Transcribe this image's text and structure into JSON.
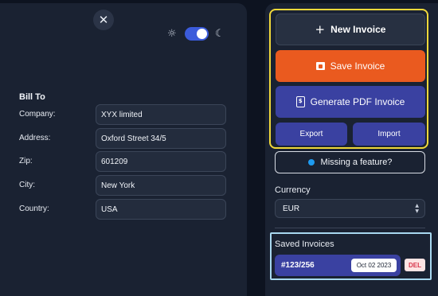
{
  "window": {
    "close_icon": "✕",
    "theme": {
      "light_icon": "☼",
      "dark_icon": "☾",
      "dark_mode_on": true
    }
  },
  "bill_to": {
    "title": "Bill To",
    "fields": [
      {
        "label": "Company:",
        "value": "XYX limited"
      },
      {
        "label": "Address:",
        "value": "Oxford Street 34/5"
      },
      {
        "label": "Zip:",
        "value": "601209"
      },
      {
        "label": "City:",
        "value": "New York"
      },
      {
        "label": "Country:",
        "value": "USA"
      }
    ]
  },
  "actions": {
    "new_icon": "+",
    "new_label": "New Invoice",
    "save_label": "Save Invoice",
    "pdf_icon": "$",
    "pdf_label": "Generate PDF Invoice",
    "export_label": "Export",
    "import_label": "Import"
  },
  "feature": {
    "label": "Missing a feature?"
  },
  "currency": {
    "label": "Currency",
    "value": "EUR"
  },
  "saved": {
    "title": "Saved Invoices",
    "items": [
      {
        "id": "#123/256",
        "date": "Oct 02 2023",
        "delete_label": "DEL"
      }
    ]
  },
  "colors": {
    "background": "#0d1320",
    "panel": "#1a2232",
    "primary": "#3a41a1",
    "save": "#ea5a1f",
    "highlight": "#f0d83a",
    "saved_outline": "#a8d8f0",
    "status_dot": "#1e9bf0"
  }
}
